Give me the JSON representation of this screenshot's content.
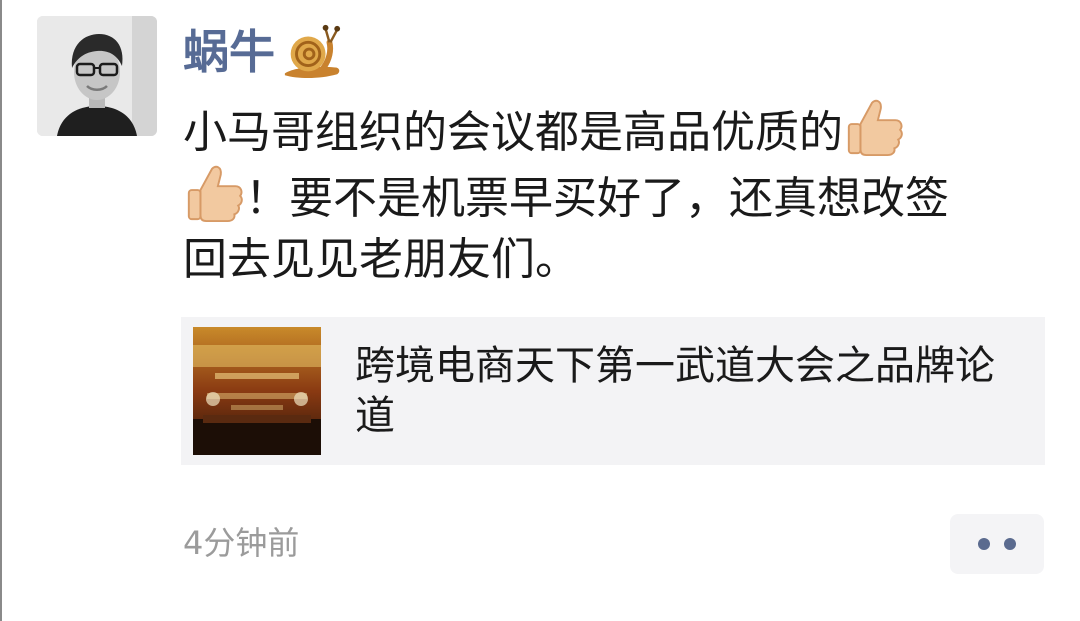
{
  "post": {
    "username": "蜗牛",
    "username_emoji": "snail-emoji",
    "text_lines": [
      "小马哥组织的会议都是高品优质的",
      "！要不是机票早买好了，还真想改签",
      "回去见见老朋友们。"
    ],
    "emoji": "thumbs-up-emoji",
    "link": {
      "title": "跨境电商天下第一武道大会之品牌论道",
      "thumbnail_alt": "conference-banner"
    },
    "timestamp": "4分钟前"
  },
  "colors": {
    "username": "#576b95",
    "text": "#1a1a1a",
    "timestamp": "#9b9b9b",
    "card_bg": "#f3f3f5",
    "more_dots": "#5b6b8f"
  }
}
